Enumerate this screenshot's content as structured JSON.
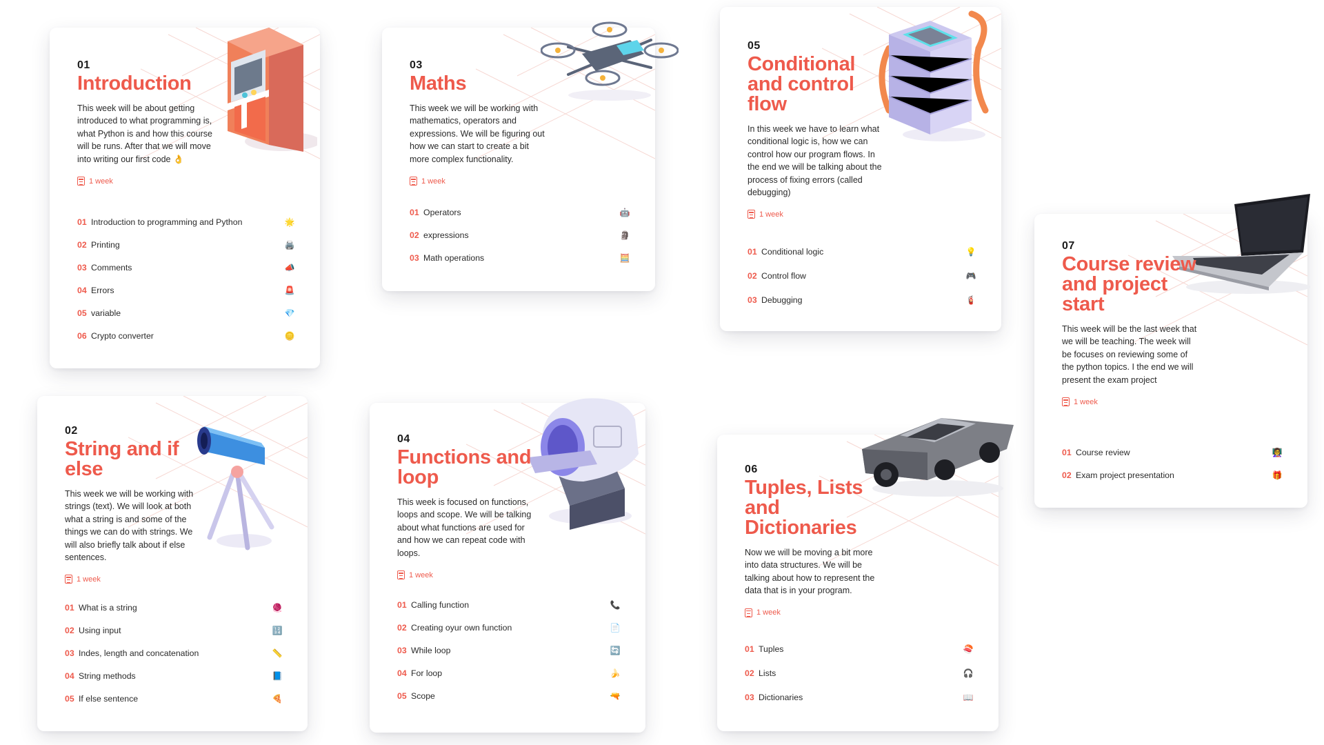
{
  "modules": [
    {
      "num": "01",
      "title": "Introduction",
      "description": "This week will be about getting introduced to what programming is, what Python is and how this course will be runs. After that we will move into writing our first code 👌",
      "duration": "1 week",
      "lessons": [
        {
          "n": "01",
          "label": "Introduction to programming and Python",
          "icon": "🌟"
        },
        {
          "n": "02",
          "label": "Printing",
          "icon": "🖨️"
        },
        {
          "n": "03",
          "label": "Comments",
          "icon": "📣"
        },
        {
          "n": "04",
          "label": "Errors",
          "icon": "🚨"
        },
        {
          "n": "05",
          "label": "variable",
          "icon": "💎"
        },
        {
          "n": "06",
          "label": "Crypto converter",
          "icon": "🪙"
        }
      ]
    },
    {
      "num": "02",
      "title": "String and if else",
      "description": "This week we will be working with strings (text). We will look at both what a string is and some of the things we can do with strings. We will also briefly talk about if else sentences.",
      "duration": "1 week",
      "lessons": [
        {
          "n": "01",
          "label": "What is a string",
          "icon": "🧶"
        },
        {
          "n": "02",
          "label": "Using input",
          "icon": "🔢"
        },
        {
          "n": "03",
          "label": "Indes, length and concatenation",
          "icon": "📏"
        },
        {
          "n": "04",
          "label": "String methods",
          "icon": "📘"
        },
        {
          "n": "05",
          "label": "If else sentence",
          "icon": "🍕"
        }
      ]
    },
    {
      "num": "03",
      "title": "Maths",
      "description": "This week we will be working with mathematics, operators and expressions. We will be figuring out how we can start to create a bit more complex functionality.",
      "duration": "1 week",
      "lessons": [
        {
          "n": "01",
          "label": "Operators",
          "icon": "🤖"
        },
        {
          "n": "02",
          "label": "expressions",
          "icon": "🗿"
        },
        {
          "n": "03",
          "label": "Math operations",
          "icon": "🧮"
        }
      ]
    },
    {
      "num": "04",
      "title": "Functions and loop",
      "description": "This week is focused on functions, loops and scope. We will be talking about what functions are used for and how we can repeat code with loops.",
      "duration": "1 week",
      "lessons": [
        {
          "n": "01",
          "label": "Calling function",
          "icon": "📞"
        },
        {
          "n": "02",
          "label": "Creating oyur own function",
          "icon": "📄"
        },
        {
          "n": "03",
          "label": "While loop",
          "icon": "🔄"
        },
        {
          "n": "04",
          "label": "For loop",
          "icon": "🍌"
        },
        {
          "n": "05",
          "label": "Scope",
          "icon": "🔫"
        }
      ]
    },
    {
      "num": "05",
      "title": "Conditional and control flow",
      "description": "In this week we have to learn what conditional logic is, how we can control how our program flows. In the end we will be talking about the process of fixing errors (called debugging)",
      "duration": "1 week",
      "lessons": [
        {
          "n": "01",
          "label": "Conditional logic",
          "icon": "💡"
        },
        {
          "n": "02",
          "label": "Control flow",
          "icon": "🎮"
        },
        {
          "n": "03",
          "label": "Debugging",
          "icon": "🧯"
        }
      ]
    },
    {
      "num": "06",
      "title": "Tuples, Lists and Dictionaries",
      "description": "Now we will be moving a bit more into data structures. We will be talking about how to represent the data that is in your program.",
      "duration": "1 week",
      "lessons": [
        {
          "n": "01",
          "label": "Tuples",
          "icon": "🍣"
        },
        {
          "n": "02",
          "label": "Lists",
          "icon": "🎧"
        },
        {
          "n": "03",
          "label": "Dictionaries",
          "icon": "📖"
        }
      ]
    },
    {
      "num": "07",
      "title": "Course review and project start",
      "description": "This week will be the last week that we will be teaching. The week will be focuses on reviewing some of the python topics. I the end we will present the exam project",
      "duration": "1 week",
      "lessons": [
        {
          "n": "01",
          "label": "Course review",
          "icon": "👩‍🏫"
        },
        {
          "n": "02",
          "label": "Exam project presentation",
          "icon": "🎁"
        }
      ]
    }
  ],
  "colors": {
    "accent": "#ee5a4c",
    "text": "#1f1f1f",
    "grid": "#f3c9c3"
  }
}
